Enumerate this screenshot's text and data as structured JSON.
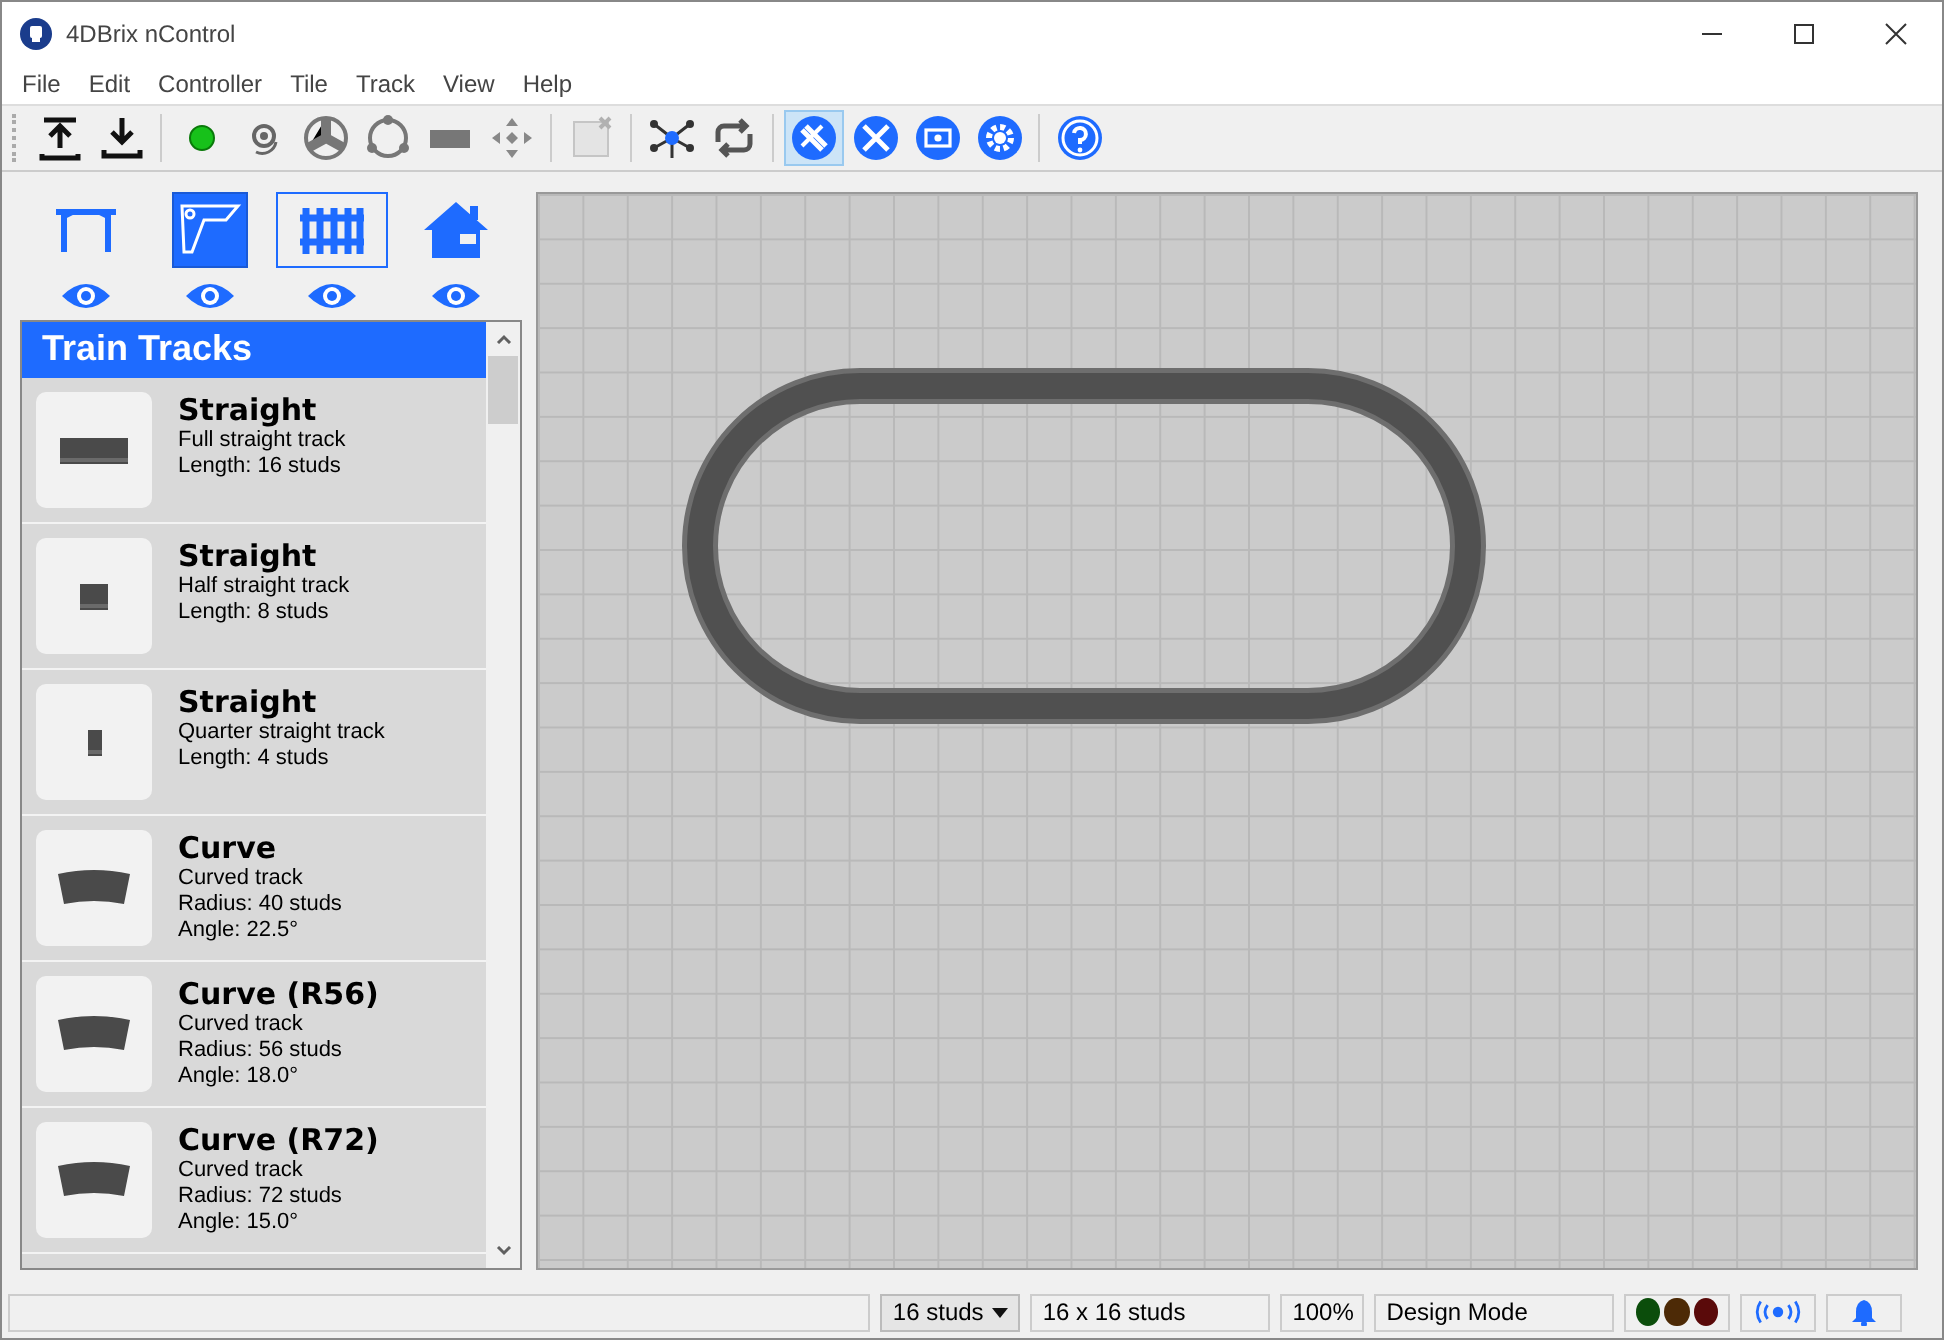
{
  "window": {
    "title": "4DBrix nControl"
  },
  "menu": [
    "File",
    "Edit",
    "Controller",
    "Tile",
    "Track",
    "View",
    "Help"
  ],
  "toolbar": [
    {
      "kind": "upload",
      "selected": false,
      "disabled": false
    },
    {
      "kind": "download",
      "selected": false,
      "disabled": false
    },
    {
      "kind": "sep"
    },
    {
      "kind": "dot",
      "selected": false,
      "disabled": false
    },
    {
      "kind": "rotate",
      "selected": false,
      "disabled": false
    },
    {
      "kind": "switch",
      "selected": false,
      "disabled": false
    },
    {
      "kind": "ring",
      "selected": false,
      "disabled": false
    },
    {
      "kind": "block",
      "selected": false,
      "disabled": false
    },
    {
      "kind": "move",
      "selected": false,
      "disabled": false
    },
    {
      "kind": "sep"
    },
    {
      "kind": "delete",
      "selected": false,
      "disabled": true
    },
    {
      "kind": "sep"
    },
    {
      "kind": "network",
      "selected": false,
      "disabled": false
    },
    {
      "kind": "loop",
      "selected": false,
      "disabled": false
    },
    {
      "kind": "sep"
    },
    {
      "kind": "design",
      "selected": true,
      "disabled": false
    },
    {
      "kind": "tools",
      "selected": false,
      "disabled": false
    },
    {
      "kind": "screen",
      "selected": false,
      "disabled": false
    },
    {
      "kind": "gear",
      "selected": false,
      "disabled": false
    },
    {
      "kind": "sep"
    },
    {
      "kind": "help",
      "selected": false,
      "disabled": false
    }
  ],
  "categories": [
    {
      "kind": "table",
      "selected": false,
      "focused": false
    },
    {
      "kind": "baseplate",
      "selected": true,
      "focused": false
    },
    {
      "kind": "track",
      "selected": false,
      "focused": true
    },
    {
      "kind": "house",
      "selected": false,
      "focused": false
    }
  ],
  "palette": {
    "title": "Train Tracks",
    "items": [
      {
        "name": "Straight",
        "kind": "straight_full",
        "lines": [
          "Full straight track",
          "Length: 16 studs"
        ]
      },
      {
        "name": "Straight",
        "kind": "straight_half",
        "lines": [
          "Half straight track",
          "Length: 8 studs"
        ]
      },
      {
        "name": "Straight",
        "kind": "straight_quarter",
        "lines": [
          "Quarter straight track",
          "Length: 4 studs"
        ]
      },
      {
        "name": "Curve",
        "kind": "curve",
        "lines": [
          "Curved track",
          "Radius: 40 studs",
          "Angle: 22.5°"
        ]
      },
      {
        "name": "Curve (R56)",
        "kind": "curve",
        "lines": [
          "Curved track",
          "Radius: 56 studs",
          "Angle: 18.0°"
        ]
      },
      {
        "name": "Curve (R72)",
        "kind": "curve",
        "lines": [
          "Curved track",
          "Radius: 72 studs",
          "Angle: 15.0°"
        ]
      }
    ]
  },
  "status_bar": {
    "grid_size": "16 studs",
    "tile": "16 x 16 studs",
    "zoom": "100%",
    "mode": "Design Mode",
    "lights": [
      {
        "color": "#0b4d0b"
      },
      {
        "color": "#4d2a06"
      },
      {
        "color": "#5a0a0a"
      }
    ]
  }
}
